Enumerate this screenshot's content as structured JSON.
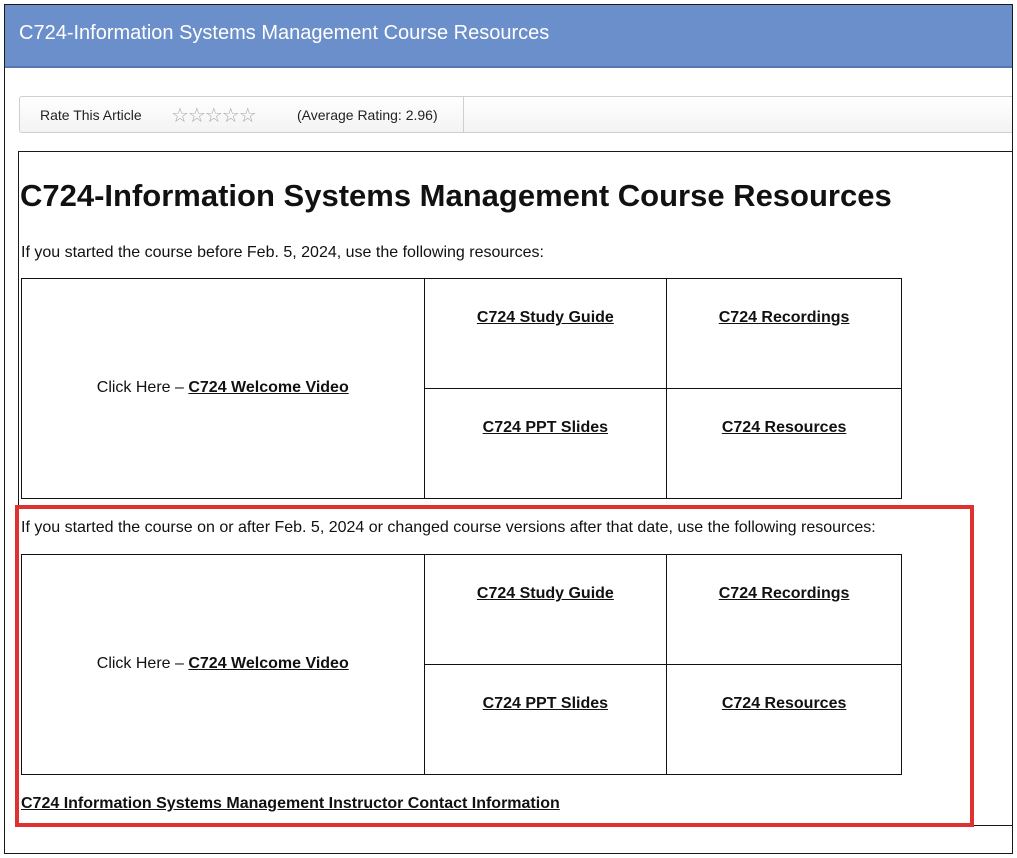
{
  "page": {
    "title": "C724-Information Systems Management Course Resources"
  },
  "rating": {
    "label": "Rate This Article",
    "stars": "☆☆☆☆☆",
    "average": "(Average Rating: 2.96)"
  },
  "article": {
    "heading": "C724-Information Systems Management Course Resources",
    "section1": {
      "intro": "If you started the course before Feb. 5, 2024, use the following resources:",
      "welcome_prefix": "Click Here – ",
      "welcome_link": "C724 Welcome Video",
      "study_guide": "C724 Study Guide",
      "recordings": "C724 Recordings",
      "ppt_slides": "C724 PPT Slides",
      "resources": "C724 Resources"
    },
    "section2": {
      "intro": "If you started the course on or after Feb. 5, 2024 or changed course versions after that date, use the following resources:",
      "welcome_prefix": "Click Here – ",
      "welcome_link": "C724 Welcome Video",
      "study_guide": "C724 Study Guide",
      "recordings": "C724 Recordings",
      "ppt_slides": "C724 PPT Slides",
      "resources": "C724 Resources"
    },
    "contact_link": "C724 Information Systems Management Instructor Contact Information"
  },
  "colors": {
    "title_bar": "#6b8fcb",
    "highlight": "#e03131"
  }
}
